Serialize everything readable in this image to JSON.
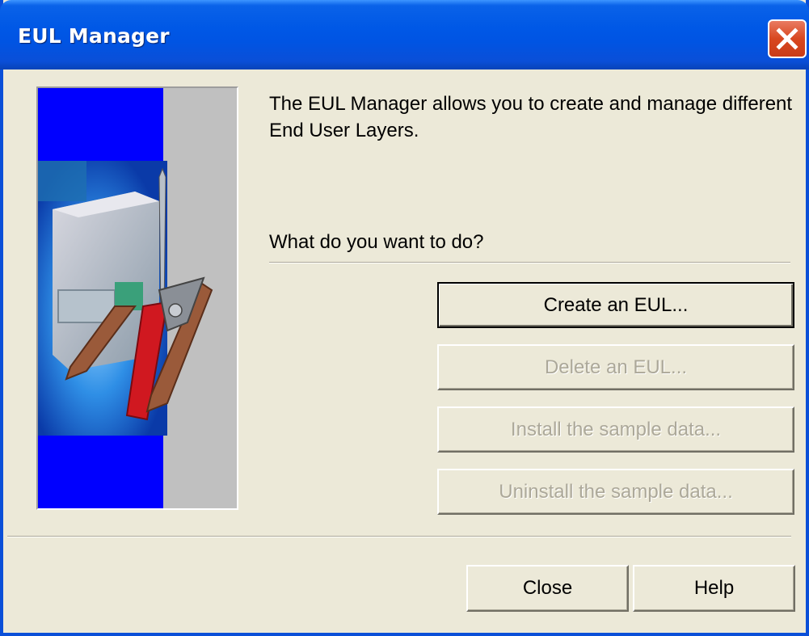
{
  "window": {
    "title": "EUL Manager",
    "colors": {
      "titlebar": "#0054e3",
      "face": "#ece9d8",
      "close_button": "#d8471f",
      "disabled_text": "#aca899"
    }
  },
  "content": {
    "intro": "The EUL Manager allows you to create and manage different End User Layers.",
    "question": "What do you want to do?"
  },
  "actions": {
    "create": "Create an EUL...",
    "delete": "Delete an EUL...",
    "install": "Install the sample data...",
    "uninstall": "Uninstall the sample data..."
  },
  "footer": {
    "close": "Close",
    "help": "Help"
  },
  "icons": {
    "close": "close-icon",
    "illustration": "tools-illustration"
  }
}
